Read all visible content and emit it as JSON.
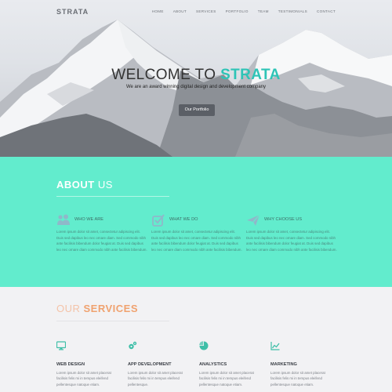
{
  "brand": {
    "logo": "STRATA",
    "accent": "#2ec4b6"
  },
  "nav": {
    "items": [
      "HOME",
      "ABOUT",
      "SERVICES",
      "PORTFOLIO",
      "TEAM",
      "TESTIMONIALS",
      "CONTACT"
    ]
  },
  "hero": {
    "title_prefix": "WELCOME TO ",
    "title_accent": "STRATA",
    "subtitle": "We are an award winning digital design and development company",
    "button_label": "Our Portfolio"
  },
  "about": {
    "title_bold": "ABOUT",
    "title_light": " US",
    "background": "#62eccd",
    "columns": [
      {
        "icon": "people-icon",
        "heading": "WHO WE ARE",
        "text": "Lorem ipsum dolor sit amet, consectetur adipiscing elit. Duis sed dapibus leo nec ornare diam. Sed commodo nibh ante facilisis bibendum dolor feugiat at. Duis sed dapibus leo nec ornare diam commodo nibh ante facilisis bibendum."
      },
      {
        "icon": "checkbox-icon",
        "heading": "WHAT WE DO",
        "text": "Lorem ipsum dolor sit amet, consectetur adipiscing elit. Duis sed dapibus leo nec ornare diam. Sed commodo nibh ante facilisis bibendum dolor feugiat at. Duis sed dapibus leo nec ornare diam commodo nibh ante facilisis bibendum."
      },
      {
        "icon": "paper-plane-icon",
        "heading": "WHY CHOOSE US",
        "text": "Lorem ipsum dolor sit amet, consectetur adipiscing elit. Duis sed dapibus leo nec ornare diam. Sed commodo nibh ante facilisis bibendum dolor feugiat at. Duis sed dapibus leo nec ornare diam commodo nibh ante facilisis bibendum."
      }
    ]
  },
  "services": {
    "title_light": "OUR ",
    "title_bold": "SERVICES",
    "items": [
      {
        "icon": "monitor-icon",
        "heading": "WEB DESIGN",
        "text": "Lorem ipsum dolor sit amet placerat facilisis felis mi in tempus eleifend pellentesque natoque etiam."
      },
      {
        "icon": "gears-icon",
        "heading": "APP DEVELOPMENT",
        "text": "Lorem ipsum dolor sit amet placerat facilisis felis mi in tempus eleifend pellentesque."
      },
      {
        "icon": "pie-chart-icon",
        "heading": "ANALYSTICS",
        "text": "Lorem ipsum dolor sit amet placerat facilisis felis mi in tempus eleifend pellentesque natoque etiam."
      },
      {
        "icon": "line-chart-icon",
        "heading": "MARKETING",
        "text": "Lorem ipsum dolor sit amet placerat facilisis felis mi in tempus eleifend pellentesque natoque etiam."
      }
    ]
  }
}
